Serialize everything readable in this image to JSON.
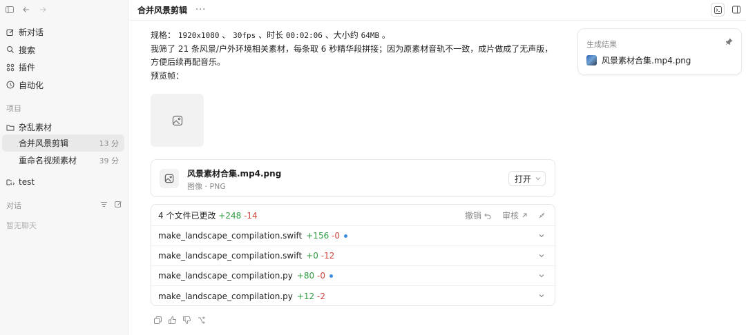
{
  "sidebar": {
    "nav": [
      {
        "label": "新对话",
        "icon": "edit-icon"
      },
      {
        "label": "搜索",
        "icon": "search-icon"
      },
      {
        "label": "插件",
        "icon": "plugin-icon"
      },
      {
        "label": "自动化",
        "icon": "clock-icon"
      }
    ],
    "projects_label": "项目",
    "folder_label": "杂乱素材",
    "threads": [
      {
        "label": "合并风景剪辑",
        "time": "13 分"
      },
      {
        "label": "重命名视频素材",
        "time": "39 分"
      }
    ],
    "test_label": "test",
    "chats_label": "对话",
    "empty_chats": "暂无聊天"
  },
  "header": {
    "title": "合并风景剪辑",
    "more": "···"
  },
  "message": {
    "spec_prefix": "规格：",
    "resolution": "1920x1080",
    "sep1": "、",
    "fps": "30fps",
    "duration_label": "、时长",
    "duration": "00:02:06",
    "size_label": "、大小约",
    "size": "64MB",
    "end": "。",
    "summary": "我筛了 21 条风景/户外环境相关素材，每条取 6 秒精华段拼接；因为原素材音轨不一致，成片做成了无声版，方便后续再配音乐。",
    "preview_label": "预览帧："
  },
  "file_card": {
    "name": "风景素材合集.mp4.png",
    "type": "图像 · PNG",
    "open_label": "打开"
  },
  "changes": {
    "summary": "4 个文件已更改",
    "added": "+248",
    "removed": "-14",
    "undo_label": "撤销",
    "review_label": "审核",
    "files": [
      {
        "name": "make_landscape_compilation.swift",
        "added": "+156",
        "removed": "-0",
        "dot": true
      },
      {
        "name": "make_landscape_compilation.swift",
        "added": "+0",
        "removed": "-12",
        "dot": false
      },
      {
        "name": "make_landscape_compilation.py",
        "added": "+80",
        "removed": "-0",
        "dot": true
      },
      {
        "name": "make_landscape_compilation.py",
        "added": "+12",
        "removed": "-2",
        "dot": false
      }
    ]
  },
  "result_panel": {
    "title": "生成结果",
    "item": "风景素材合集.mp4.png"
  },
  "colors": {
    "added": "#2e9a3f",
    "removed": "#d1433b",
    "dot": "#3b8de0"
  }
}
